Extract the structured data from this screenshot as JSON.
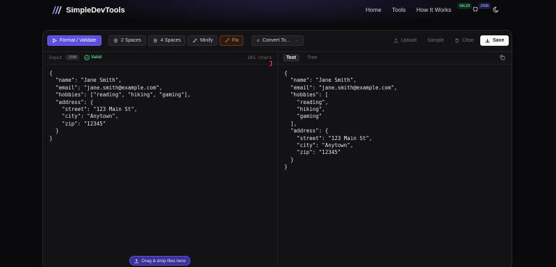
{
  "header": {
    "brand": "SimpleDevTools",
    "nav": [
      "Home",
      "Tools",
      "How It Works"
    ],
    "icons": [
      "github-icon",
      "moon-icon"
    ]
  },
  "toolbar": {
    "format_label": "Format / Validate",
    "two_spaces_label": "2 Spaces",
    "four_spaces_label": "4 Spaces",
    "minify_label": "Minify",
    "fix_label": "Fix",
    "convert_label": "Convert To...",
    "upload_label": "Upload",
    "sample_label": "Sample",
    "clear_label": "Clear",
    "save_label": "Save"
  },
  "input_panel": {
    "label": "Input",
    "format_badge": "JSON",
    "status": "Valid",
    "char_count": "201 chars",
    "code": "{\n  \"name\": \"Jane Smith\",\n  \"email\": \"jane.smith@example.com\",\n  \"hobbies\": [\"reading\", \"hiking\", \"gaming\"],\n  \"address\": {\n    \"street\": \"123 Main St\",\n    \"city\": \"Anytown\",\n    \"zip\": \"12345\"\n  }\n}"
  },
  "output_panel": {
    "tabs": [
      "Text",
      "Tree"
    ],
    "active_tab": "Text",
    "status_badge": "VALID",
    "format_badge": "JSON",
    "code": "{\n  \"name\": \"Jane Smith\",\n  \"email\": \"jane.smith@example.com\",\n  \"hobbies\": [\n    \"reading\",\n    \"hiking\",\n    \"gaming\"\n  ],\n  \"address\": {\n    \"street\": \"123 Main St\",\n    \"city\": \"Anytown\",\n    \"zip\": \"12345\"\n  }\n}"
  },
  "dropzone": {
    "label": "Drag & drop files here"
  },
  "colors": {
    "accent": "#5b4ee0",
    "valid": "#4ade80",
    "fix": "#f0a060",
    "background": "#09090b"
  }
}
